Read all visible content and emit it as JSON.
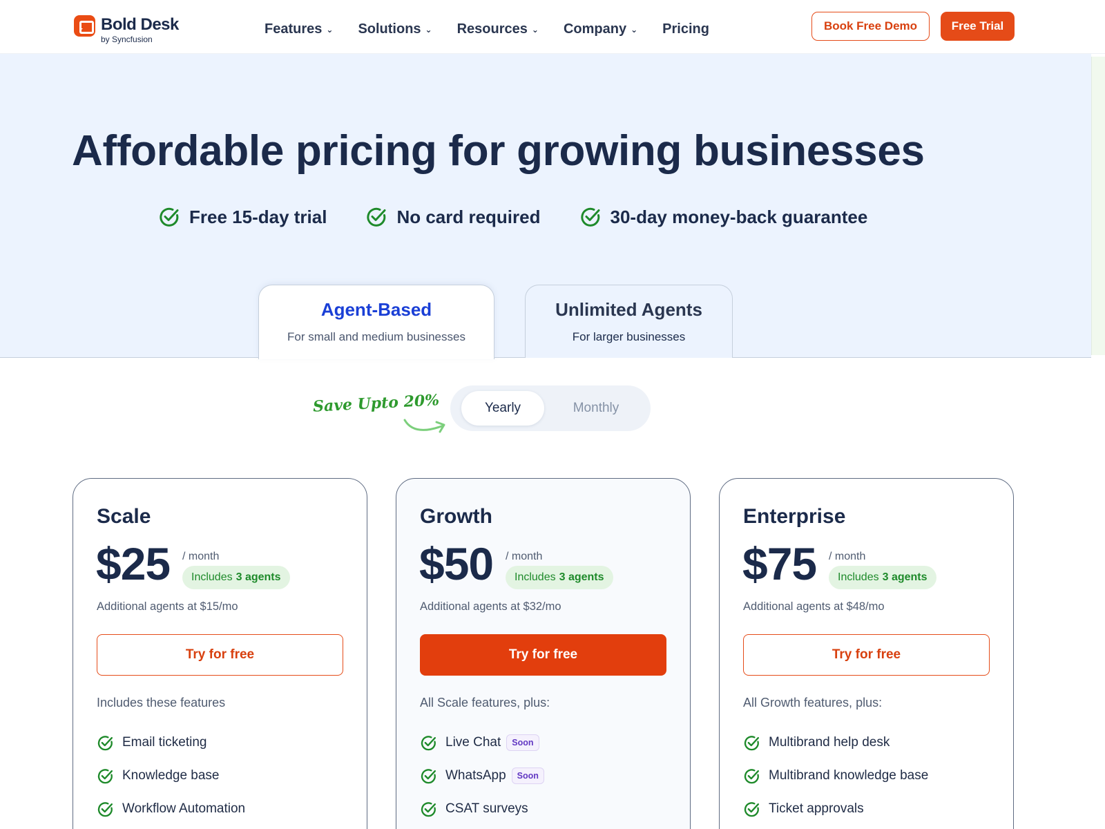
{
  "brand": {
    "name": "Bold Desk",
    "byline": "by Syncfusion",
    "accent": "#e54b18"
  },
  "nav": {
    "items": [
      {
        "label": "Features",
        "has_dropdown": true
      },
      {
        "label": "Solutions",
        "has_dropdown": true
      },
      {
        "label": "Resources",
        "has_dropdown": true
      },
      {
        "label": "Company",
        "has_dropdown": true
      },
      {
        "label": "Pricing",
        "has_dropdown": false
      }
    ],
    "dropdown_icon": "chevron-down-icon",
    "demo_label": "Book Free Demo",
    "trial_label": "Free Trial"
  },
  "hero": {
    "title": "Affordable pricing for growing businesses",
    "benefits": [
      {
        "icon": "check-circle-icon",
        "text": "Free 15-day trial"
      },
      {
        "icon": "check-circle-icon",
        "text": "No card required"
      },
      {
        "icon": "check-circle-icon",
        "text": "30-day money-back guarantee"
      }
    ]
  },
  "plan_tabs": [
    {
      "title": "Agent-Based",
      "subtitle": "For small and medium businesses",
      "active": true
    },
    {
      "title": "Unlimited Agents",
      "subtitle": "For larger businesses",
      "active": false
    }
  ],
  "billing": {
    "save_note": "Save Upto 20%",
    "options": [
      "Yearly",
      "Monthly"
    ],
    "selected": "Yearly"
  },
  "plans": [
    {
      "name": "Scale",
      "price": "$25",
      "period": "/ month",
      "includes_prefix": "Includes",
      "includes_agents": "3 agents",
      "extra_agents": "Additional agents at $15/mo",
      "cta": "Try for free",
      "cta_style": "outline",
      "features_intro": "Includes these features",
      "features": [
        {
          "label": "Email ticketing",
          "badge": ""
        },
        {
          "label": "Knowledge base",
          "badge": ""
        },
        {
          "label": "Workflow Automation",
          "badge": ""
        }
      ]
    },
    {
      "name": "Growth",
      "price": "$50",
      "period": "/ month",
      "includes_prefix": "Includes",
      "includes_agents": "3 agents",
      "extra_agents": "Additional agents at $32/mo",
      "cta": "Try for free",
      "cta_style": "filled",
      "features_intro": "All Scale features, plus:",
      "features": [
        {
          "label": "Live Chat",
          "badge": "Soon"
        },
        {
          "label": "WhatsApp",
          "badge": "Soon"
        },
        {
          "label": "CSAT surveys",
          "badge": ""
        }
      ]
    },
    {
      "name": "Enterprise",
      "price": "$75",
      "period": "/ month",
      "includes_prefix": "Includes",
      "includes_agents": "3 agents",
      "extra_agents": "Additional agents at $48/mo",
      "cta": "Try for free",
      "cta_style": "outline",
      "features_intro": "All Growth features, plus:",
      "features": [
        {
          "label": "Multibrand help desk",
          "badge": ""
        },
        {
          "label": "Multibrand knowledge base",
          "badge": ""
        },
        {
          "label": "Ticket approvals",
          "badge": ""
        }
      ]
    }
  ],
  "colors": {
    "primary_text": "#1b2a4a",
    "tab_active_title": "#1a3fd6",
    "hero_background": "#ecf3fe",
    "check_green": "#1e8a2a",
    "save_note_green": "#2e9a2e",
    "cta_filled": "#e23e0d",
    "soon_badge": "#6238c3"
  }
}
